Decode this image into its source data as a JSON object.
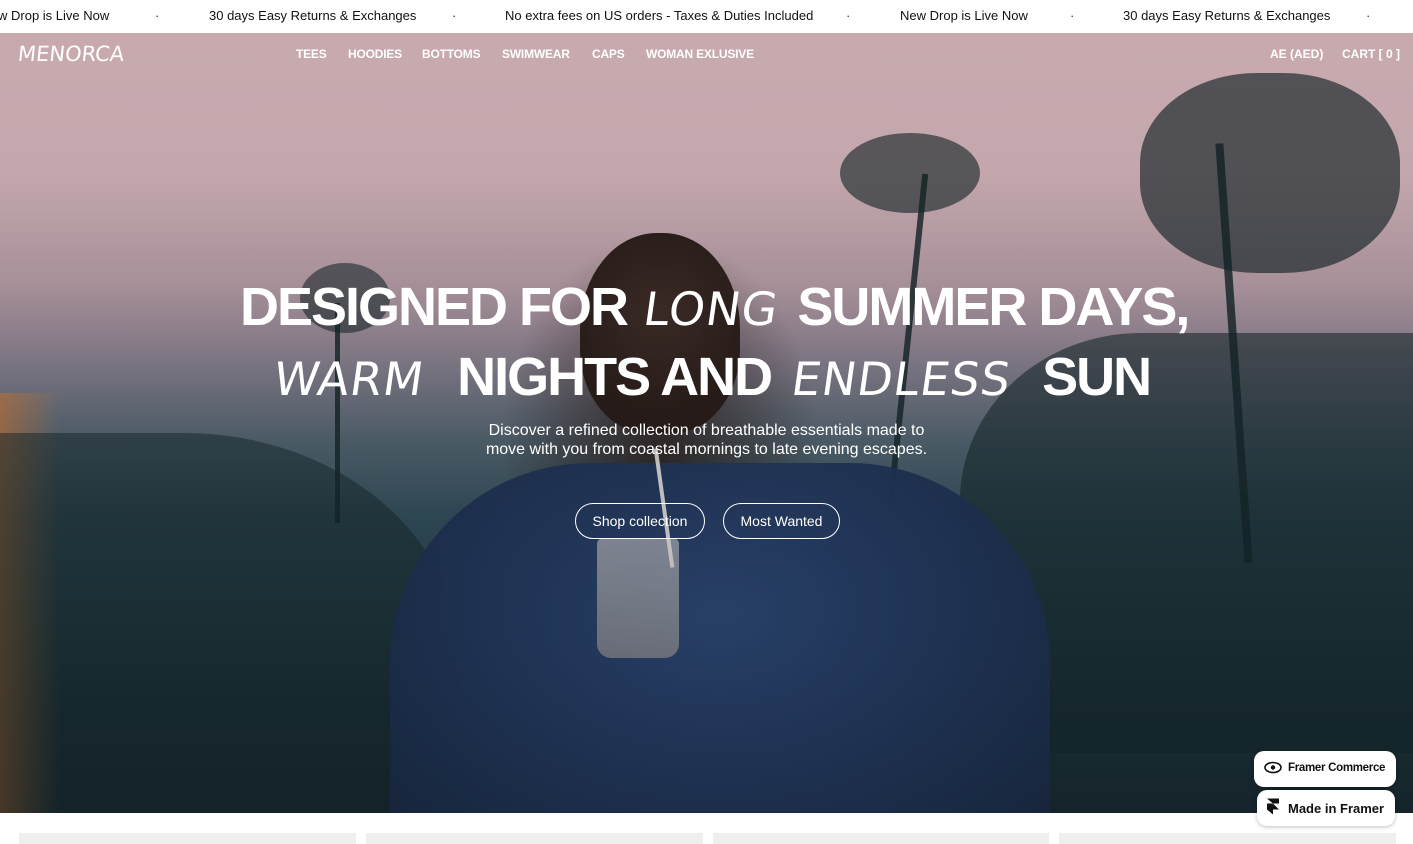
{
  "announcement": {
    "messages": [
      "w Drop is Live Now",
      "30 days Easy Returns & Exchanges",
      "No extra fees on US orders - Taxes & Duties Included",
      "New Drop is Live Now",
      "30 days Easy Returns & Exchanges"
    ],
    "separator": "·"
  },
  "header": {
    "logo": "MENORCA",
    "nav": [
      "TEES",
      "HOODIES",
      "BOTTOMS",
      "SWIMWEAR",
      "CAPS",
      "WOMAN EXLUSIVE"
    ],
    "currency": "AE (AED)",
    "cart": "CART [ 0 ]"
  },
  "hero": {
    "line1_a": "DESIGNED FOR",
    "line1_script": "LONG",
    "line1_b": "SUMMER DAYS,",
    "line2_script_a": "WARM",
    "line2_a": "NIGHTS AND",
    "line2_script_b": "ENDLESS",
    "line2_b": "SUN",
    "subtitle_line1": "Discover a refined collection of breathable essentials made to",
    "subtitle_line2": "move with you from coastal mornings to late evening escapes.",
    "primary_button": "Shop collection",
    "secondary_button": "Most Wanted"
  },
  "badges": {
    "commerce": "Framer Commerce",
    "made_in": "Made in Framer"
  },
  "colors": {
    "text_on_hero": "#ffffff",
    "announcement_bg": "#ffffff",
    "announcement_text": "#111111"
  }
}
